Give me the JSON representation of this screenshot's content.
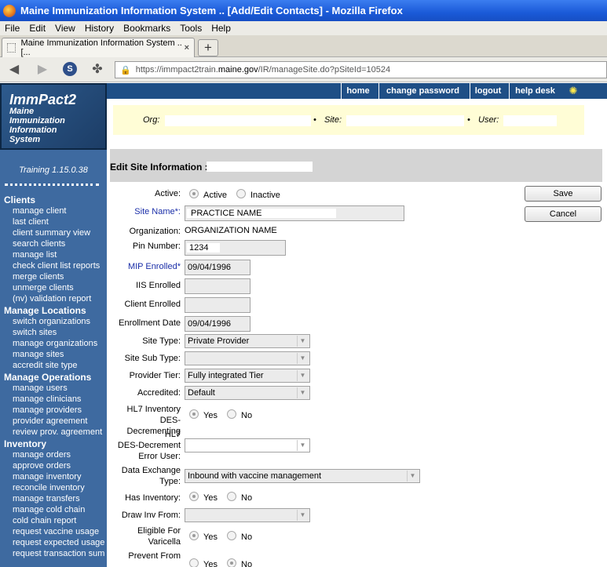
{
  "window": {
    "title": "Maine Immunization Information System .. [Add/Edit Contacts] - Mozilla Firefox"
  },
  "menubar": [
    "File",
    "Edit",
    "View",
    "History",
    "Bookmarks",
    "Tools",
    "Help"
  ],
  "tab": {
    "title": "Maine Immunization Information System .. [...",
    "close": "×",
    "new_tab": "+"
  },
  "url": {
    "prefix": "https://immpact2train.",
    "domain": "maine.gov",
    "path": "/IR/manageSite.do?pSiteId=10524"
  },
  "logo": {
    "title": "ImmPact2",
    "subtitle_lines": [
      "Maine",
      "Immunization",
      "Information",
      "System"
    ]
  },
  "training": "Training 1.15.0.38",
  "topnav": [
    "home",
    "change password",
    "logout",
    "help desk"
  ],
  "orgbar": {
    "org_label": "Org:",
    "site_label": "Site:",
    "user_label": "User:"
  },
  "edit_header": "Edit Site Information :",
  "sidebar": {
    "sections": [
      {
        "title": "Clients",
        "links": [
          "manage client",
          "last client",
          "client summary view",
          "search clients",
          "manage list",
          "check client list reports",
          "merge clients",
          "unmerge clients",
          "(nv) validation report"
        ]
      },
      {
        "title": "Manage Locations",
        "links": [
          "switch organizations",
          "switch sites",
          "manage organizations",
          "manage sites",
          "accredit site type"
        ]
      },
      {
        "title": "Manage Operations",
        "links": [
          "manage users",
          "manage clinicians",
          "manage providers",
          "provider agreement",
          "review prov. agreement"
        ]
      },
      {
        "title": "Inventory",
        "links": [
          "manage orders",
          "approve orders",
          "manage inventory",
          "reconcile inventory",
          "manage transfers",
          "manage cold chain",
          "cold chain report",
          "request vaccine usage",
          "request expected usage",
          "request transaction sum"
        ]
      }
    ]
  },
  "buttons": {
    "save": "Save",
    "cancel": "Cancel"
  },
  "form": {
    "active_label": "Active:",
    "active_opt": "Active",
    "inactive_opt": "Inactive",
    "site_name_label": "Site Name*:",
    "site_name": "PRACTICE NAME",
    "organization_label": "Organization:",
    "organization": "ORGANIZATION NAME",
    "pin_label": "Pin Number:",
    "pin": "1234",
    "mip_label": "MIP Enrolled*",
    "mip": "09/04/1996",
    "iis_label": "IIS Enrolled",
    "client_enrolled_label": "Client Enrolled",
    "enrollment_date_label": "Enrollment Date",
    "enrollment_date": "09/04/1996",
    "site_type_label": "Site Type:",
    "site_type": "Private Provider",
    "site_sub_type_label": "Site Sub Type:",
    "provider_tier_label": "Provider Tier:",
    "provider_tier": "Fully integrated Tier",
    "accredited_label": "Accredited:",
    "accredited": "Default",
    "hl7_inv_label_1": "HL7 Inventory",
    "hl7_inv_label_2": "DES-Decrementing",
    "hl7_err_label_1": "HL7",
    "hl7_err_label_2": "DES-Decrement",
    "hl7_err_label_3": "Error User:",
    "data_exchange_label_1": "Data Exchange",
    "data_exchange_label_2": "Type:",
    "data_exchange": "Inbound with vaccine management",
    "has_inventory_label": "Has Inventory:",
    "draw_inv_label": "Draw Inv From:",
    "varicella_label_1": "Eligible For",
    "varicella_label_2": "Varicella",
    "prevent_label": "Prevent From",
    "yes": "Yes",
    "no": "No"
  }
}
